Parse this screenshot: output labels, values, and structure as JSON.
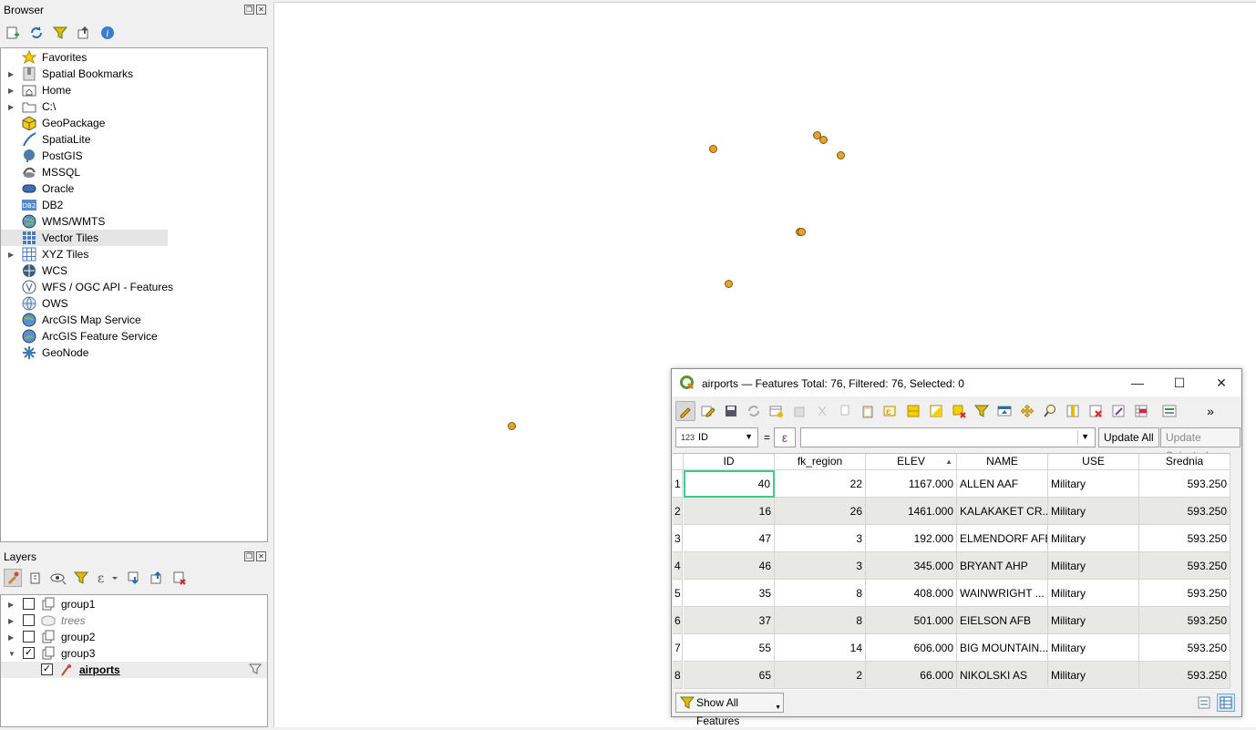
{
  "browser": {
    "title": "Browser",
    "items": [
      {
        "label": "Favorites",
        "icon": "star-icon",
        "expandable": false
      },
      {
        "label": "Spatial Bookmarks",
        "icon": "bookmark-icon",
        "expandable": true
      },
      {
        "label": "Home",
        "icon": "home-folder-icon",
        "expandable": true
      },
      {
        "label": "C:\\",
        "icon": "folder-icon",
        "expandable": true
      },
      {
        "label": "GeoPackage",
        "icon": "geopackage-icon",
        "expandable": false
      },
      {
        "label": "SpatiaLite",
        "icon": "spatialite-icon",
        "expandable": false
      },
      {
        "label": "PostGIS",
        "icon": "postgis-icon",
        "expandable": false
      },
      {
        "label": "MSSQL",
        "icon": "mssql-icon",
        "expandable": false
      },
      {
        "label": "Oracle",
        "icon": "oracle-icon",
        "expandable": false
      },
      {
        "label": "DB2",
        "icon": "db2-icon",
        "expandable": false
      },
      {
        "label": "WMS/WMTS",
        "icon": "globe-icon",
        "expandable": false
      },
      {
        "label": "Vector Tiles",
        "icon": "vector-tiles-icon",
        "expandable": false,
        "selected": true
      },
      {
        "label": "XYZ Tiles",
        "icon": "xyz-tiles-icon",
        "expandable": true
      },
      {
        "label": "WCS",
        "icon": "wcs-icon",
        "expandable": false
      },
      {
        "label": "WFS / OGC API - Features",
        "icon": "wfs-icon",
        "expandable": false
      },
      {
        "label": "OWS",
        "icon": "ows-icon",
        "expandable": false
      },
      {
        "label": "ArcGIS Map Service",
        "icon": "arcgis-map-icon",
        "expandable": false
      },
      {
        "label": "ArcGIS Feature Service",
        "icon": "arcgis-feature-icon",
        "expandable": false
      },
      {
        "label": "GeoNode",
        "icon": "geonode-icon",
        "expandable": false
      }
    ]
  },
  "layers": {
    "title": "Layers",
    "items": [
      {
        "label": "group1",
        "checked": false,
        "expand": "collapsed",
        "italic": false
      },
      {
        "label": "trees",
        "checked": false,
        "expand": "collapsed",
        "italic": true
      },
      {
        "label": "group2",
        "checked": false,
        "expand": "collapsed",
        "italic": false
      },
      {
        "label": "group3",
        "checked": true,
        "expand": "expanded",
        "italic": false
      },
      {
        "label": "airports",
        "checked": true,
        "expand": "none",
        "italic": false,
        "bold": true,
        "child": true
      }
    ]
  },
  "attribute_table": {
    "title": "airports — Features Total: 76, Filtered: 76, Selected: 0",
    "field_type": "123",
    "field": "ID",
    "equals": "=",
    "epsilon": "ε",
    "update_all": "Update All",
    "update_selected": "Update Selected",
    "columns": [
      "ID",
      "fk_region",
      "ELEV",
      "NAME",
      "USE",
      "Srednia"
    ],
    "rows": [
      {
        "n": "1",
        "ID": "40",
        "fk_region": "22",
        "ELEV": "1167.000",
        "NAME": "ALLEN AAF",
        "USE": "Military",
        "Srednia": "593.250"
      },
      {
        "n": "2",
        "ID": "16",
        "fk_region": "26",
        "ELEV": "1461.000",
        "NAME": "KALAKAKET CR...",
        "USE": "Military",
        "Srednia": "593.250"
      },
      {
        "n": "3",
        "ID": "47",
        "fk_region": "3",
        "ELEV": "192.000",
        "NAME": "ELMENDORF AFB",
        "USE": "Military",
        "Srednia": "593.250"
      },
      {
        "n": "4",
        "ID": "46",
        "fk_region": "3",
        "ELEV": "345.000",
        "NAME": "BRYANT AHP",
        "USE": "Military",
        "Srednia": "593.250"
      },
      {
        "n": "5",
        "ID": "35",
        "fk_region": "8",
        "ELEV": "408.000",
        "NAME": "WAINWRIGHT ...",
        "USE": "Military",
        "Srednia": "593.250"
      },
      {
        "n": "6",
        "ID": "37",
        "fk_region": "8",
        "ELEV": "501.000",
        "NAME": "EIELSON AFB",
        "USE": "Military",
        "Srednia": "593.250"
      },
      {
        "n": "7",
        "ID": "55",
        "fk_region": "14",
        "ELEV": "606.000",
        "NAME": "BIG MOUNTAIN...",
        "USE": "Military",
        "Srednia": "593.250"
      },
      {
        "n": "8",
        "ID": "65",
        "fk_region": "2",
        "ELEV": "66.000",
        "NAME": "NIKOLSKI AS",
        "USE": "Military",
        "Srednia": "593.250"
      }
    ],
    "show_all": "Show All Features",
    "more": "»"
  },
  "colors": {
    "point_fill": "#e8a32a",
    "focus": "#3cc98a",
    "qgis_green": "#589632"
  }
}
